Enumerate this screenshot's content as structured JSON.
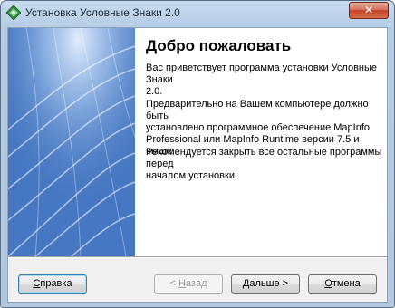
{
  "window": {
    "title": "Установка Условные Знаки 2.0",
    "app_icon": "installer-diamond-icon",
    "close_icon": "close-icon",
    "close_glyph": "✕"
  },
  "welcome": {
    "heading": "Добро пожаловать",
    "paragraphs": [
      "Вас приветствует программа установки Условные Знаки\n2.0.",
      "Предварительно на Вашем компьютере должно быть\nустановлено программное обеспечение MapInfo\nProfessional или MapInfo Runtime версии 7.5 и выше.",
      "Рекомендуется закрыть все остальные программы перед\nначалом установки."
    ]
  },
  "buttons": {
    "help": {
      "label": "Справка",
      "accel": "С",
      "rest": "правка"
    },
    "back": {
      "label": "< Назад",
      "pre": "< ",
      "accel": "Н",
      "rest": "азад"
    },
    "next": {
      "label": "Дальше >",
      "pre": "",
      "accel": "Д",
      "rest": "альше >"
    },
    "cancel": {
      "label": "Отмена",
      "accel": "О",
      "rest": "тмена"
    }
  },
  "colors": {
    "banner": "#4a7ec8",
    "title_bar": "#c9dbee",
    "close_button": "#c4432d",
    "dialog_background": "#f0f0f0"
  }
}
